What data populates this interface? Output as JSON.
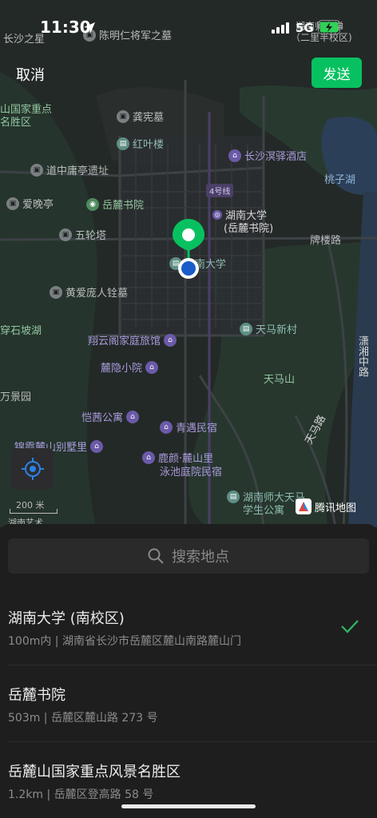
{
  "status_bar": {
    "time": "11:30",
    "network": "5G"
  },
  "header": {
    "cancel_label": "取消",
    "send_label": "发送"
  },
  "map": {
    "pois": [
      {
        "key": "general_tomb",
        "label": "陈明仁将军之墓",
        "icon": "tomb-icon"
      },
      {
        "key": "north_label",
        "label": "长沙之星",
        "icon": "pin-icon"
      },
      {
        "key": "hunan_normal_top",
        "label": "湖南师大学",
        "icon": "none"
      },
      {
        "key": "hunan_normal_top2",
        "label": "（二里半校区)",
        "icon": "none"
      },
      {
        "key": "yuelu_scenic_1",
        "label": "山国家重点",
        "icon": "none"
      },
      {
        "key": "yuelu_scenic_2",
        "label": "名胜区",
        "icon": "none"
      },
      {
        "key": "gongxian_tomb",
        "label": "龚宪墓",
        "icon": "tomb-icon"
      },
      {
        "key": "hongye_lou",
        "label": "红叶楼",
        "icon": "building-icon"
      },
      {
        "key": "changsha_hotel",
        "label": "长沙溟驿酒店",
        "icon": "hotel-icon"
      },
      {
        "key": "taozi_lake",
        "label": "桃子湖",
        "icon": "none"
      },
      {
        "key": "daozhong",
        "label": "道中庸亭遗址",
        "icon": "tomb-icon"
      },
      {
        "key": "yuelu_academy",
        "label": "岳麓书院",
        "icon": "camera-icon"
      },
      {
        "key": "line4",
        "label": "4号线",
        "icon": "none"
      },
      {
        "key": "aiwan",
        "label": "爱晚亭",
        "icon": "tomb-icon"
      },
      {
        "key": "hunan_univ_1",
        "label": "湖南大学",
        "icon": "school-icon"
      },
      {
        "key": "hunan_univ_2",
        "label": "(岳麓书院)",
        "icon": "none"
      },
      {
        "key": "wulun",
        "label": "五轮塔",
        "icon": "tomb-icon"
      },
      {
        "key": "pailou_road",
        "label": "牌楼路",
        "icon": "none"
      },
      {
        "key": "nandaxue",
        "label": "南大学",
        "icon": "building-icon"
      },
      {
        "key": "huang_ai",
        "label": "黄爱庞人铨墓",
        "icon": "tomb-icon"
      },
      {
        "key": "chuanshi",
        "label": "穿石坡湖",
        "icon": "none"
      },
      {
        "key": "xiangyun",
        "label": "翔云阁家庭旅馆",
        "icon": "hotel-icon"
      },
      {
        "key": "tianma_village",
        "label": "天马新村",
        "icon": "building-icon"
      },
      {
        "key": "xiangjiang_road",
        "label": "潇湘中路",
        "icon": "none"
      },
      {
        "key": "luyin",
        "label": "麓隐小院",
        "icon": "hotel-icon"
      },
      {
        "key": "tianma_mtn",
        "label": "天马山",
        "icon": "none"
      },
      {
        "key": "wanjing",
        "label": "万景园",
        "icon": "tomb-icon"
      },
      {
        "key": "kaixi",
        "label": "恺茜公寓",
        "icon": "hotel-icon"
      },
      {
        "key": "qingyu",
        "label": "青遇民宿",
        "icon": "hotel-icon"
      },
      {
        "key": "jinxiu",
        "label": "锦霞麓山别墅里",
        "icon": "hotel-icon"
      },
      {
        "key": "tianma_road",
        "label": "天马路",
        "icon": "none"
      },
      {
        "key": "luyan_1",
        "label": "鹿颜·麓山里",
        "icon": "hotel-icon"
      },
      {
        "key": "luyan_2",
        "label": "泳池庭院民宿",
        "icon": "none"
      },
      {
        "key": "normal_apt_1",
        "label": "湖南师大天马",
        "icon": "building-icon"
      },
      {
        "key": "normal_apt_2",
        "label": "学生公寓",
        "icon": "none"
      },
      {
        "key": "bottom_cut",
        "label": "湖南艺术",
        "icon": "none"
      }
    ],
    "scale_label": "200 米",
    "brand_label": "腾讯地图"
  },
  "search": {
    "placeholder": "搜索地点"
  },
  "results": [
    {
      "name": "湖南大学 (南校区)",
      "address": "100m内 | 湖南省长沙市岳麓区麓山南路麓山门",
      "selected": true
    },
    {
      "name": "岳麓书院",
      "address": "503m | 岳麓区麓山路 273 号",
      "selected": false
    },
    {
      "name": "岳麓山国家重点风景名胜区",
      "address": "1.2km | 岳麓区登高路 58 号",
      "selected": false
    }
  ],
  "colors": {
    "accent_green": "#07c160",
    "check_green": "#2fb861",
    "pin_blue": "#1a5cc8"
  }
}
